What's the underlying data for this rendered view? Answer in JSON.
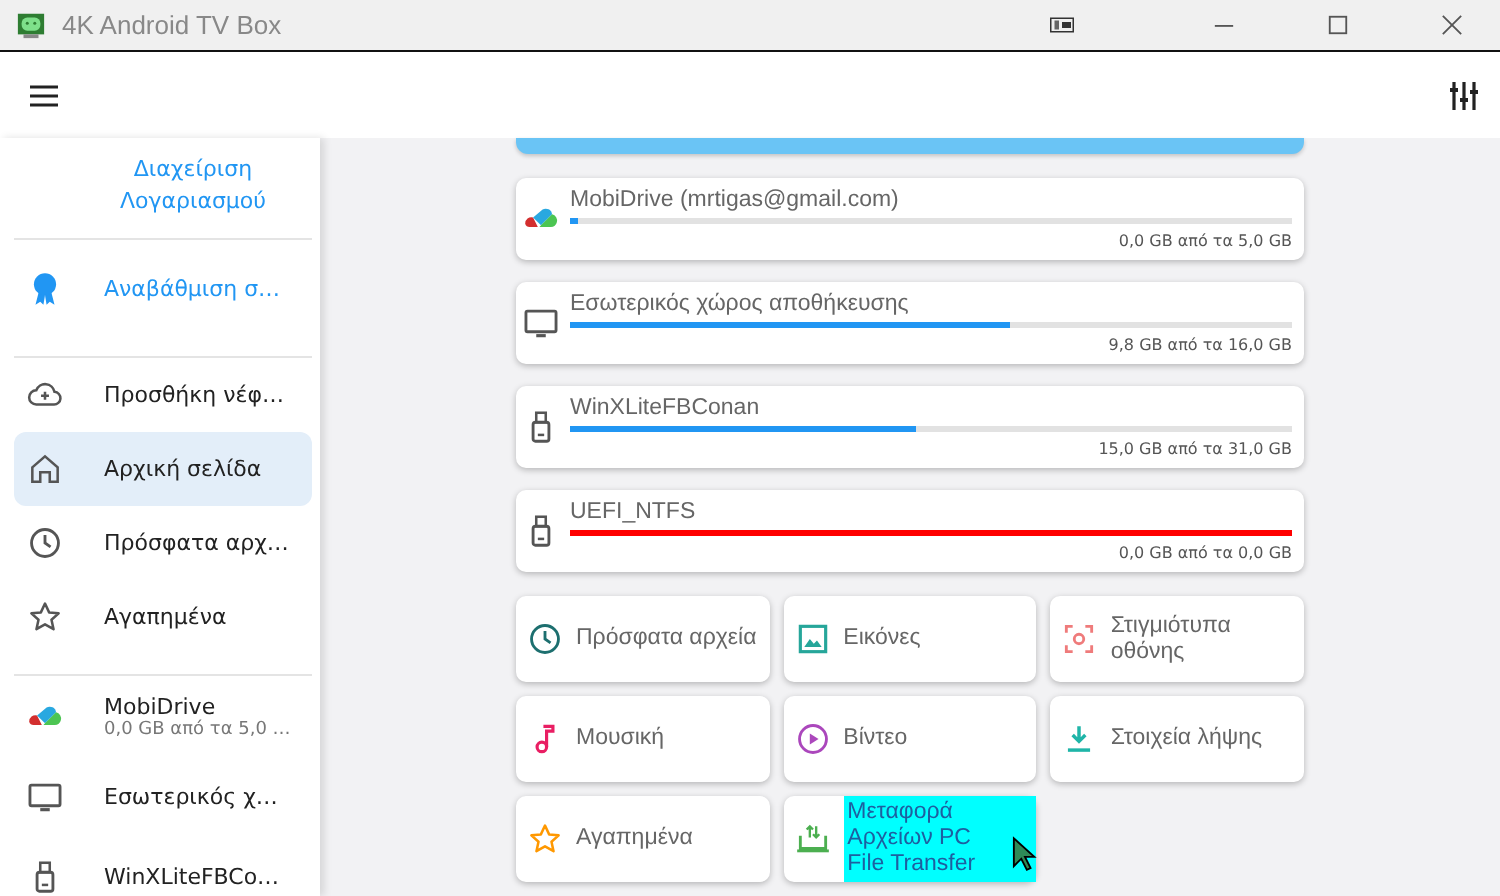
{
  "window": {
    "title": "4K Android TV Box"
  },
  "sidebar": {
    "account_link": "Διαχείριση Λογαριασμού",
    "upgrade": "Αναβάθμιση σ…",
    "items": [
      {
        "kind": "cloud",
        "label": "Προσθήκη νέφ…",
        "selected": false
      },
      {
        "kind": "home",
        "label": "Αρχική σελίδα",
        "selected": true
      },
      {
        "kind": "recent",
        "label": "Πρόσφατα αρχ…",
        "selected": false
      },
      {
        "kind": "star",
        "label": "Αγαπημένα",
        "selected": false
      }
    ],
    "storage": [
      {
        "kind": "mobidrive",
        "label": "MobiDrive",
        "subtitle": "0,0 GB από τα 5,0 …"
      },
      {
        "kind": "monitor",
        "label": "Εσωτερικός χ…"
      },
      {
        "kind": "usb",
        "label": "WinXLiteFBCo…"
      }
    ]
  },
  "storage_cards": [
    {
      "kind": "mobidrive",
      "name": "MobiDrive (mrtigas@gmail.com)",
      "level": 0.01,
      "alert": false,
      "usage": "0,0 GB από τα 5,0 GB"
    },
    {
      "kind": "monitor",
      "name": "Εσωτερικός χώρος αποθήκευσης",
      "level": 0.61,
      "alert": false,
      "usage": "9,8 GB από τα 16,0 GB"
    },
    {
      "kind": "usb",
      "name": "WinXLiteFBConan",
      "level": 0.48,
      "alert": false,
      "usage": "15,0 GB από τα 31,0 GB"
    },
    {
      "kind": "usb",
      "name": "UEFI_NTFS",
      "level": 1,
      "alert": true,
      "usage": "0,0 GB από τα 0,0 GB"
    }
  ],
  "shortcuts": [
    {
      "kind": "recent",
      "label": "Πρόσφατα αρχεία",
      "highlighted": false
    },
    {
      "kind": "images",
      "label": "Εικόνες",
      "highlighted": false
    },
    {
      "kind": "screenshot",
      "label": "Στιγμιότυπα οθόνης",
      "highlighted": false
    },
    {
      "kind": "music",
      "label": "Μουσική",
      "highlighted": false
    },
    {
      "kind": "video",
      "label": "Βίντεο",
      "highlighted": false
    },
    {
      "kind": "download",
      "label": "Στοιχεία λήψης",
      "highlighted": false
    },
    {
      "kind": "star",
      "label": "Αγαπημένα",
      "highlighted": false
    },
    {
      "kind": "transfer",
      "label": "Μεταφορά Αρχείων PC File Transfer",
      "highlighted": true
    }
  ]
}
